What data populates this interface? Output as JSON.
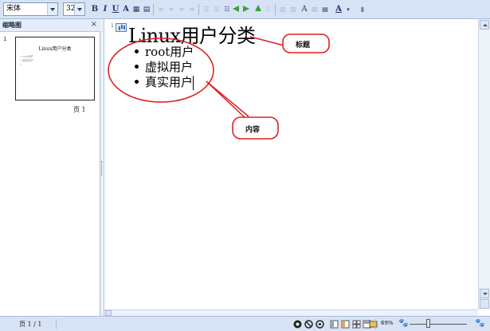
{
  "toolbar": {
    "font_name": "宋体",
    "font_size": "32",
    "bold_label": "B",
    "italic_label": "I",
    "underline_label": "U",
    "shadow_label": "A",
    "font_color_label": "A"
  },
  "thumbnail_pane": {
    "title": "缩略图",
    "close_label": "×",
    "slide_number": "1",
    "slide_title": "Linux用户分类",
    "slide_bullets": [
      "• root用户",
      "• 虚拟用户",
      "•"
    ],
    "page_label": "页 1"
  },
  "document": {
    "line_number": "1",
    "title": "Linux用户分类",
    "bullets": [
      "root用户",
      "虚拟用户",
      "真实用户"
    ]
  },
  "callouts": {
    "title_label": "标题",
    "content_label": "内容"
  },
  "status_bar": {
    "page_indicator": "页 1 / 1",
    "zoom": "69%"
  },
  "colors": {
    "toolbar_bg": "#d7e3f5",
    "callout_red": "#e02020",
    "arrow_green": "#3aa23a"
  }
}
